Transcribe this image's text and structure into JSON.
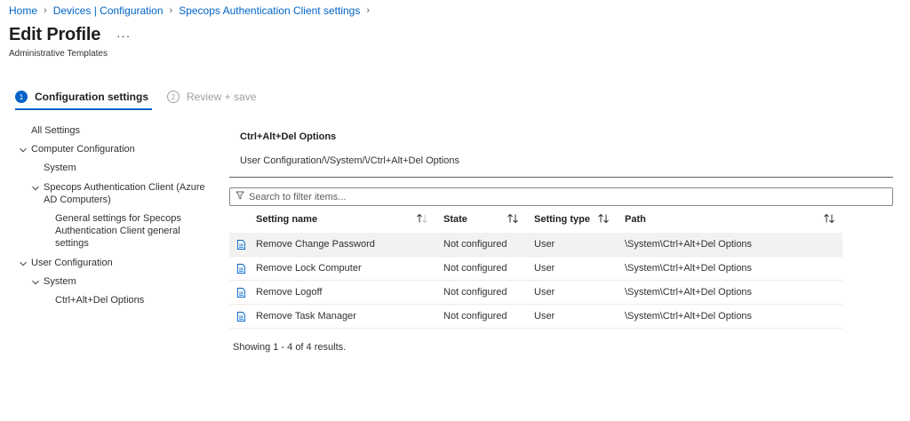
{
  "breadcrumb": [
    "Home",
    "Devices | Configuration",
    "Specops Authentication Client settings"
  ],
  "page": {
    "title": "Edit Profile",
    "more": "···",
    "subtitle": "Administrative Templates"
  },
  "steps": [
    {
      "num": "1",
      "label": "Configuration settings",
      "state": "active"
    },
    {
      "num": "2",
      "label": "Review + save",
      "state": "inactive"
    }
  ],
  "tree": {
    "all_settings": "All Settings",
    "computer_configuration": "Computer Configuration",
    "computer_system": "System",
    "specops_client_line1": "Specops Authentication Client (Azure",
    "specops_client_line2": "AD Computers)",
    "general_line1": "General settings for Specops",
    "general_line2": "Authentication Client general",
    "general_line3": "settings",
    "user_configuration": "User Configuration",
    "user_system": "System",
    "ctrl_alt_del": "Ctrl+Alt+Del Options"
  },
  "section": {
    "title": "Ctrl+Alt+Del Options",
    "path": "User Configuration/\\/System/\\/Ctrl+Alt+Del Options"
  },
  "filter": {
    "placeholder": "Search to filter items..."
  },
  "table": {
    "columns": [
      "Setting name",
      "State",
      "Setting type",
      "Path"
    ],
    "rows": [
      {
        "name": "Remove Change Password",
        "state": "Not configured",
        "type": "User",
        "path": "\\System\\Ctrl+Alt+Del Options"
      },
      {
        "name": "Remove Lock Computer",
        "state": "Not configured",
        "type": "User",
        "path": "\\System\\Ctrl+Alt+Del Options"
      },
      {
        "name": "Remove Logoff",
        "state": "Not configured",
        "type": "User",
        "path": "\\System\\Ctrl+Alt+Del Options"
      },
      {
        "name": "Remove Task Manager",
        "state": "Not configured",
        "type": "User",
        "path": "\\System\\Ctrl+Alt+Del Options"
      }
    ]
  },
  "results": "Showing 1 - 4 of 4 results.",
  "colors": {
    "accent": "#0064c6",
    "text": "#323130",
    "muted": "#a19f9d"
  }
}
